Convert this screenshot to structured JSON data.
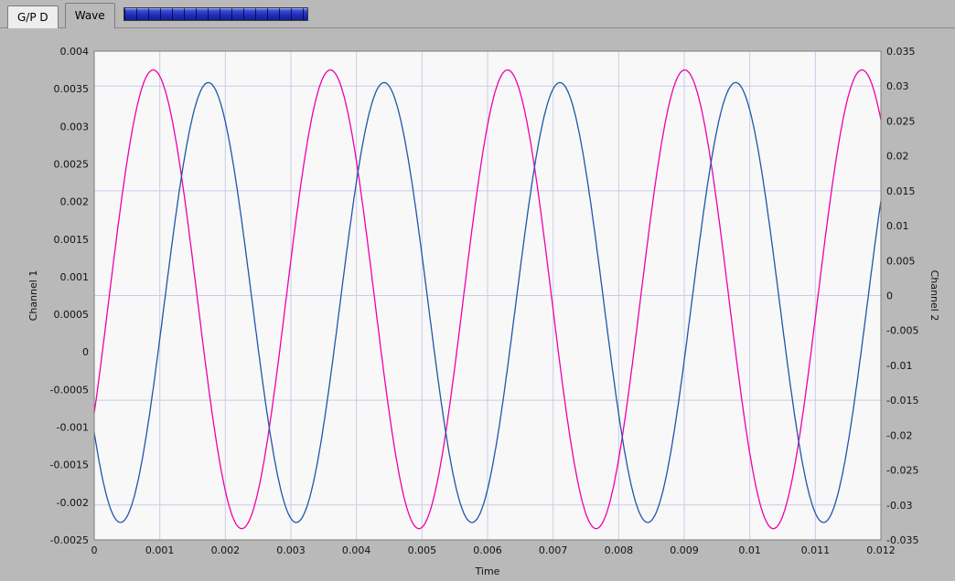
{
  "window": {
    "background": "#b9b9b9"
  },
  "tabs": [
    {
      "label": "G/P D",
      "active": false
    },
    {
      "label": "Wave",
      "active": true
    }
  ],
  "progress_indicator": {
    "segments": 16,
    "color": "#1e2db4"
  },
  "chart_data": {
    "type": "line",
    "title": "",
    "xlabel": "Time",
    "ylabel_left": "Channel 1",
    "ylabel_right": "Channel 2",
    "plot_background": "#f8f8f8",
    "x_range": [
      0,
      0.012
    ],
    "y_left_range": [
      -0.0025,
      0.004
    ],
    "y_right_range": [
      -0.035,
      0.035
    ],
    "x_tick_values": [
      0,
      0.001,
      0.002,
      0.003,
      0.004,
      0.005,
      0.006,
      0.007,
      0.008,
      0.009,
      0.01,
      0.011,
      0.012
    ],
    "x_tick_labels": [
      "0",
      "0.001",
      "0.002",
      "0.003",
      "0.004",
      "0.005",
      "0.006",
      "0.007",
      "0.008",
      "0.009",
      "0.01",
      "0.011",
      "0.012"
    ],
    "y_left_tick_values": [
      0.004,
      0.0035,
      0.003,
      0.0025,
      0.002,
      0.0015,
      0.001,
      0.0005,
      0,
      -0.0005,
      -0.001,
      -0.0015,
      -0.002,
      -0.0025
    ],
    "y_left_tick_labels": [
      "0.004",
      "0.0035",
      "0.003",
      "0.0025",
      "0.002",
      "0.0015",
      "0.001",
      "0.0005",
      "0",
      "-0.0005",
      "-0.001",
      "-0.0015",
      "-0.002",
      "-0.0025"
    ],
    "y_right_tick_values": [
      0.035,
      0.03,
      0.025,
      0.02,
      0.015,
      0.01,
      0.005,
      0,
      -0.005,
      -0.01,
      -0.015,
      -0.02,
      -0.025,
      -0.03,
      -0.035
    ],
    "y_right_tick_labels": [
      "0.035",
      "0.03",
      "0.025",
      "0.02",
      "0.015",
      "0.01",
      "0.005",
      "0",
      "-0.005",
      "-0.01",
      "-0.015",
      "-0.02",
      "-0.025",
      "-0.03",
      "-0.035"
    ],
    "grid": {
      "color": "#c9cce8",
      "vertical_at_x": [
        0.001,
        0.002,
        0.003,
        0.004,
        0.005,
        0.006,
        0.007,
        0.008,
        0.009,
        0.01,
        0.011
      ],
      "horizontal_at_right": [
        0.03,
        0.015,
        0,
        -0.015,
        -0.03
      ]
    },
    "series": [
      {
        "name": "Channel 1",
        "axis": "left",
        "color": "#ee00aa",
        "waveform": "sine",
        "amplitude": 0.00305,
        "offset": 0.0007,
        "frequency_hz": 370,
        "phase_rad": -0.52
      },
      {
        "name": "Channel 2",
        "axis": "right",
        "color": "#1f56a8",
        "waveform": "sine",
        "amplitude": 0.0315,
        "offset": -0.001,
        "frequency_hz": 373,
        "phase_rad": -2.51
      }
    ]
  }
}
